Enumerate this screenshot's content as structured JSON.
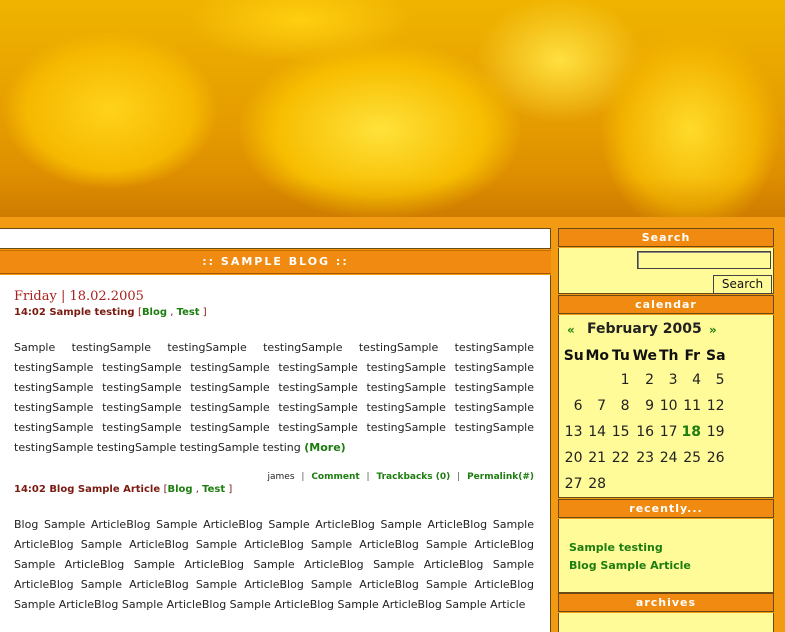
{
  "main": {
    "bar_title": ":: SAMPLE BLOG ::",
    "date": "Friday | 18.02.2005",
    "posts": [
      {
        "time_title": "14:02 Sample testing",
        "cat_open": "[",
        "cat1": "Blog",
        "cat_sep": ",",
        "cat2": "Test",
        "cat_close": "]",
        "body": "Sample testingSample testingSample testingSample testingSample testingSample testingSample testingSample testingSample testingSample testingSample testingSample testingSample testingSample testingSample testingSample testingSample testingSample testingSample testingSample testingSample testingSample testingSample testingSample testingSample testingSample testingSample testingSample testingSample testingSample testingSample testingSample testingSample testing",
        "more": "(More)",
        "author": "james",
        "comment": "Comment",
        "trackbacks": "Trackbacks (0)",
        "permalink": "Permalink(#)"
      },
      {
        "time_title": "14:02 Blog Sample Article",
        "cat_open": "[",
        "cat1": "Blog",
        "cat_sep": ",",
        "cat2": "Test",
        "cat_close": "]",
        "body": "Blog Sample ArticleBlog Sample ArticleBlog Sample ArticleBlog Sample ArticleBlog Sample ArticleBlog Sample ArticleBlog Sample ArticleBlog Sample ArticleBlog Sample ArticleBlog Sample ArticleBlog Sample ArticleBlog Sample ArticleBlog Sample ArticleBlog Sample ArticleBlog Sample ArticleBlog Sample ArticleBlog Sample ArticleBlog Sample ArticleBlog Sample ArticleBlog Sample ArticleBlog Sample ArticleBlog Sample ArticleBlog Sample Article"
      }
    ],
    "sep": "|"
  },
  "sidebar": {
    "search_title": "Search",
    "search_button": "Search",
    "search_value": "",
    "calendar_title": "calendar",
    "calendar": {
      "prev": "«",
      "next": "»",
      "month": "February 2005",
      "weekdays": [
        "Su",
        "Mo",
        "Tu",
        "We",
        "Th",
        "Fr",
        "Sa"
      ],
      "weeks": [
        [
          "",
          "",
          "1",
          "2",
          "3",
          "4",
          "5"
        ],
        [
          "6",
          "7",
          "8",
          "9",
          "10",
          "11",
          "12"
        ],
        [
          "13",
          "14",
          "15",
          "16",
          "17",
          "18",
          "19"
        ],
        [
          "20",
          "21",
          "22",
          "23",
          "24",
          "25",
          "26"
        ],
        [
          "27",
          "28",
          "",
          "",
          "",
          "",
          ""
        ]
      ],
      "today": "18"
    },
    "recently_title": "recently...",
    "recently": [
      "Sample testing",
      "Blog Sample Article"
    ],
    "archives_title": "archives"
  },
  "colors": {
    "accent": "#f08a10",
    "sidebar_bg": "#fffb98",
    "link": "#1d7d0f",
    "date": "#a8221d"
  }
}
